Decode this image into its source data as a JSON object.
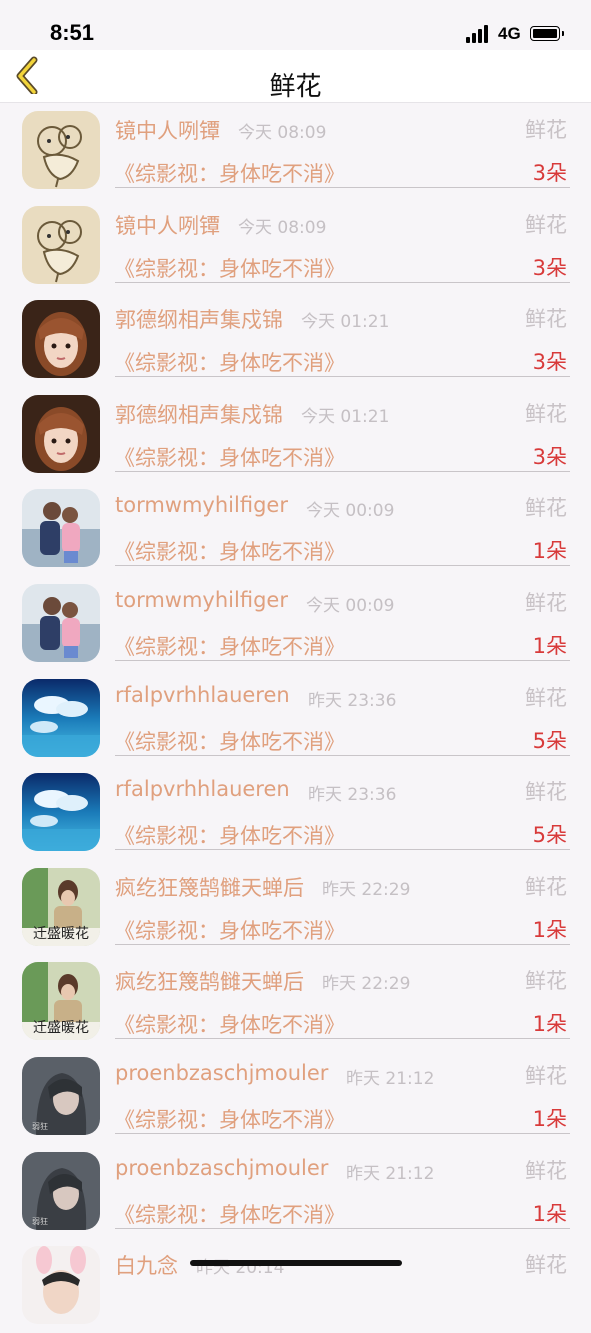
{
  "status": {
    "time": "8:51",
    "network": "4G"
  },
  "nav": {
    "title": "鲜花"
  },
  "items": [
    {
      "name": "镜中人咧镡",
      "time": "今天 08:09",
      "type": "鲜花",
      "book": "《综影视：身体吃不消》",
      "count": "3朵",
      "avatar": "sketch"
    },
    {
      "name": "镜中人咧镡",
      "time": "今天 08:09",
      "type": "鲜花",
      "book": "《综影视：身体吃不消》",
      "count": "3朵",
      "avatar": "sketch"
    },
    {
      "name": "郭德纲相声集戍锦",
      "time": "今天 01:21",
      "type": "鲜花",
      "book": "《综影视：身体吃不消》",
      "count": "3朵",
      "avatar": "girl-bangs"
    },
    {
      "name": "郭德纲相声集戍锦",
      "time": "今天 01:21",
      "type": "鲜花",
      "book": "《综影视：身体吃不消》",
      "count": "3朵",
      "avatar": "girl-bangs"
    },
    {
      "name": "tormwmyhilfiger",
      "time": "今天 00:09",
      "type": "鲜花",
      "book": "《综影视：身体吃不消》",
      "count": "1朵",
      "avatar": "hug"
    },
    {
      "name": "tormwmyhilfiger",
      "time": "今天 00:09",
      "type": "鲜花",
      "book": "《综影视：身体吃不消》",
      "count": "1朵",
      "avatar": "hug"
    },
    {
      "name": "rfalpvrhhlaueren",
      "time": "昨天 23:36",
      "type": "鲜花",
      "book": "《综影视：身体吃不消》",
      "count": "5朵",
      "avatar": "sky"
    },
    {
      "name": "rfalpvrhhlaueren",
      "time": "昨天 23:36",
      "type": "鲜花",
      "book": "《综影视：身体吃不消》",
      "count": "5朵",
      "avatar": "sky"
    },
    {
      "name": "疯纥狂篾鹄雠天蝉后",
      "time": "昨天 22:29",
      "type": "鲜花",
      "book": "《综影视：身体吃不消》",
      "count": "1朵",
      "avatar": "green",
      "avatar_caption": "迁盛暖花"
    },
    {
      "name": "疯纥狂篾鹄雠天蝉后",
      "time": "昨天 22:29",
      "type": "鲜花",
      "book": "《综影视：身体吃不消》",
      "count": "1朵",
      "avatar": "green",
      "avatar_caption": "迁盛暖花"
    },
    {
      "name": "proenbzaschjmouler",
      "time": "昨天 21:12",
      "type": "鲜花",
      "book": "《综影视：身体吃不消》",
      "count": "1朵",
      "avatar": "dark"
    },
    {
      "name": "proenbzaschjmouler",
      "time": "昨天 21:12",
      "type": "鲜花",
      "book": "《综影视：身体吃不消》",
      "count": "1朵",
      "avatar": "dark"
    },
    {
      "name": "白九念",
      "time": "昨天 20:14",
      "type": "鲜花",
      "book": "",
      "count": "",
      "avatar": "bunny"
    }
  ]
}
